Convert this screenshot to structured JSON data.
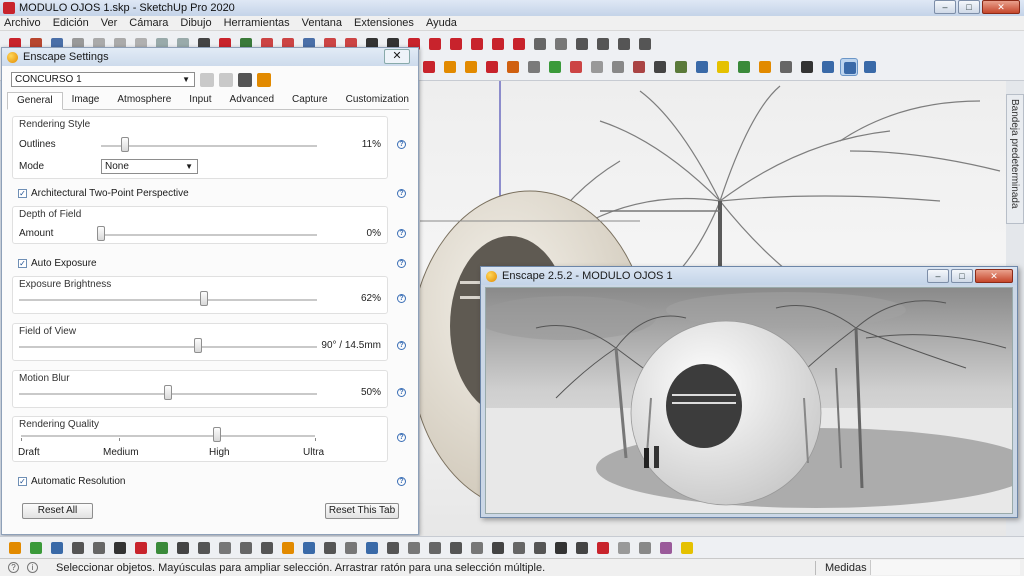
{
  "window": {
    "title": "MODULO OJOS 1.skp - SketchUp Pro 2020",
    "controls": [
      "–",
      "□",
      "✕"
    ]
  },
  "menu": [
    "Archivo",
    "Edición",
    "Ver",
    "Cámara",
    "Dibujo",
    "Herramientas",
    "Ventana",
    "Extensiones",
    "Ayuda"
  ],
  "tray": {
    "label": "Bandeja predeterminada"
  },
  "enscape_settings": {
    "title": "Enscape Settings",
    "close": "✕",
    "preset": "CONCURSO 1",
    "tabs": [
      "General",
      "Image",
      "Atmosphere",
      "Input",
      "Advanced",
      "Capture",
      "Customization"
    ],
    "active_tab": "General",
    "help_glyph": "?",
    "check_glyph": "✓",
    "rendering_style": {
      "heading": "Rendering Style",
      "outlines_label": "Outlines",
      "outlines_value": "11%",
      "outlines_level": 0.11,
      "mode_label": "Mode",
      "mode_value": "None"
    },
    "two_point_perspective": {
      "label": "Architectural Two-Point Perspective",
      "checked": true
    },
    "depth_of_field": {
      "heading": "Depth of Field",
      "amount_label": "Amount",
      "amount_value": "0%",
      "level": 0.0
    },
    "auto_exposure": {
      "label": "Auto Exposure",
      "checked": true
    },
    "exposure_brightness": {
      "heading": "Exposure Brightness",
      "value": "62%",
      "level": 0.62
    },
    "field_of_view": {
      "heading": "Field of View",
      "value": "90° / 14.5mm",
      "level": 0.6
    },
    "motion_blur": {
      "heading": "Motion Blur",
      "value": "50%",
      "level": 0.5
    },
    "rendering_quality": {
      "heading": "Rendering Quality",
      "levels": [
        "Draft",
        "Medium",
        "High",
        "Ultra"
      ],
      "selected": "High"
    },
    "automatic_resolution": {
      "label": "Automatic Resolution",
      "checked": true
    },
    "buttons": {
      "reset_all": "Reset All",
      "reset_tab": "Reset This Tab"
    }
  },
  "render_window": {
    "title": "Enscape 2.5.2 - MODULO OJOS 1",
    "controls": [
      "–",
      "□",
      "✕"
    ]
  },
  "status": {
    "text": "Seleccionar objetos. Mayúsculas para ampliar selección. Arrastrar ratón para una selección múltiple.",
    "measure_label": "Medidas"
  },
  "colors": {
    "sketchup_red": "#c8232c",
    "enscape_orange": "#e28a00",
    "title_blue": "#c4d3e8"
  }
}
